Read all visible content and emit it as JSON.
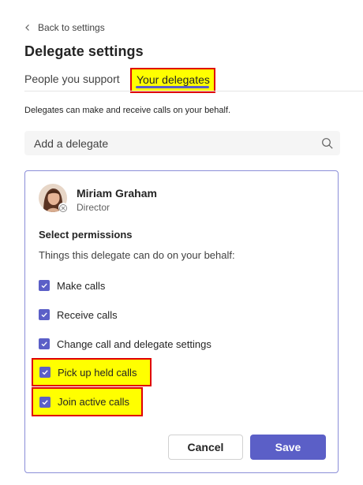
{
  "nav": {
    "back_label": "Back to settings"
  },
  "page": {
    "title": "Delegate settings"
  },
  "tabs": [
    {
      "label": "People you support",
      "active": false
    },
    {
      "label": "Your delegates",
      "active": true
    }
  ],
  "description": "Delegates can make and receive calls on your behalf.",
  "search": {
    "placeholder": "Add a delegate"
  },
  "delegate": {
    "name": "Miriam Graham",
    "role": "Director",
    "permissions_title": "Select permissions",
    "permissions_subtitle": "Things this delegate can do on your behalf:",
    "permissions": [
      {
        "label": "Make calls",
        "checked": true
      },
      {
        "label": "Receive calls",
        "checked": true
      },
      {
        "label": "Change call and delegate settings",
        "checked": true
      },
      {
        "label": "Pick up held calls",
        "checked": true
      },
      {
        "label": "Join active calls",
        "checked": true
      }
    ]
  },
  "buttons": {
    "cancel": "Cancel",
    "save": "Save"
  },
  "colors": {
    "accent": "#5b5fc7",
    "highlight": "#ffff00",
    "highlight_border": "#e00000"
  }
}
